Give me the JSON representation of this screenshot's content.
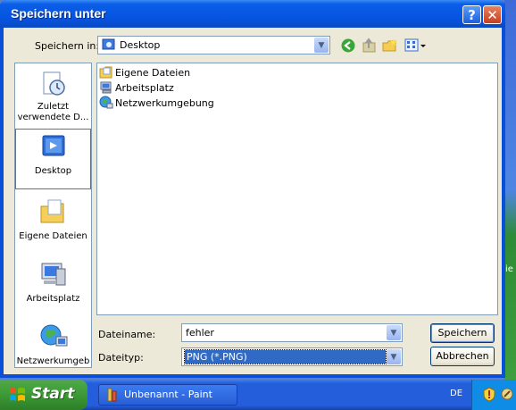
{
  "window": {
    "title": "Speichern unter"
  },
  "toolbar": {
    "save_in_label": "Speichern in:",
    "save_in_value": "Desktop",
    "icons": [
      "back-icon",
      "up-folder-icon",
      "new-folder-icon",
      "view-menu-icon"
    ]
  },
  "places": [
    {
      "label": "Zuletzt verwendete D...",
      "icon": "recent-documents-icon"
    },
    {
      "label": "Desktop",
      "icon": "desktop-icon",
      "selected": true
    },
    {
      "label": "Eigene Dateien",
      "icon": "my-documents-icon"
    },
    {
      "label": "Arbeitsplatz",
      "icon": "my-computer-icon"
    },
    {
      "label": "Netzwerkumgeb",
      "icon": "network-places-icon"
    }
  ],
  "files": [
    {
      "name": "Eigene Dateien",
      "icon": "folder-icon"
    },
    {
      "name": "Arbeitsplatz",
      "icon": "computer-icon"
    },
    {
      "name": "Netzwerkumgebung",
      "icon": "network-icon"
    }
  ],
  "form": {
    "filename_label": "Dateiname:",
    "filename_value": "fehler",
    "filetype_label": "Dateityp:",
    "filetype_value": "PNG (*.PNG)"
  },
  "buttons": {
    "save": "Speichern",
    "cancel": "Abbrechen"
  },
  "taskbar": {
    "start_label": "Start",
    "task_label": "Unbenannt - Paint",
    "language": "DE"
  },
  "colors": {
    "title_blue": "#0a5ee8",
    "dialog_bg": "#ece9d8",
    "selection_blue": "#316ac5"
  }
}
